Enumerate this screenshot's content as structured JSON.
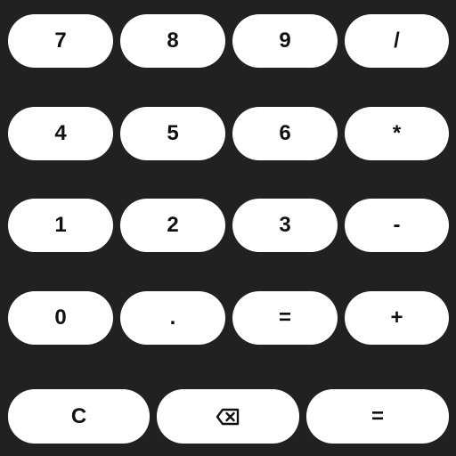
{
  "keypad": {
    "rows": [
      [
        "7",
        "8",
        "9",
        "/"
      ],
      [
        "4",
        "5",
        "6",
        "*"
      ],
      [
        "1",
        "2",
        "3",
        "-"
      ],
      [
        "0",
        ".",
        "=",
        "+"
      ]
    ],
    "bottom": {
      "clear": "C",
      "backspace_icon": "backspace-icon",
      "equals": "="
    }
  },
  "colors": {
    "background": "#212121",
    "key": "#ffffff",
    "key_text": "#111111"
  }
}
